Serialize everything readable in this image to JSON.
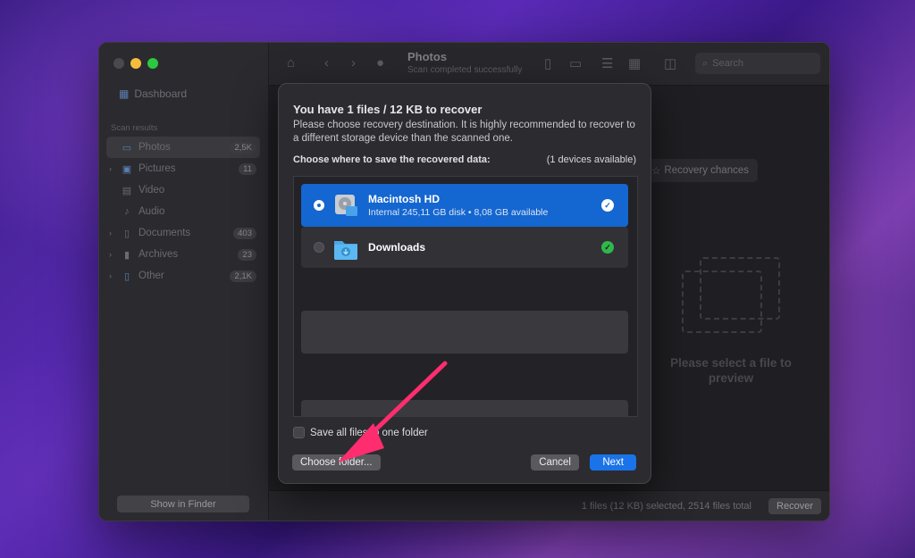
{
  "sidebar": {
    "dashboard_label": "Dashboard",
    "section_label": "Scan results",
    "items": [
      {
        "label": "Photos",
        "count": "2,5K",
        "icon": "hard-drive-icon"
      },
      {
        "label": "Pictures",
        "count": "11",
        "icon": "picture-icon"
      },
      {
        "label": "Video",
        "count": "",
        "icon": "film-icon"
      },
      {
        "label": "Audio",
        "count": "",
        "icon": "music-note-icon"
      },
      {
        "label": "Documents",
        "count": "403",
        "icon": "document-icon"
      },
      {
        "label": "Archives",
        "count": "23",
        "icon": "archive-icon"
      },
      {
        "label": "Other",
        "count": "2,1K",
        "icon": "file-icon"
      }
    ],
    "show_in_finder": "Show in Finder"
  },
  "toolbar": {
    "title": "Photos",
    "subtitle": "Scan completed successfully",
    "search_placeholder": "Search"
  },
  "main": {
    "recovery_chances": "Recovery chances",
    "preview_text": "Please select a file to preview"
  },
  "statusbar": {
    "status_text": "1 files (12 KB) selected, 2514 files total",
    "recover_label": "Recover"
  },
  "dialog": {
    "title": "You have 1 files / 12 KB to recover",
    "description": "Please choose recovery destination. It is highly recommended to recover to a different storage device than the scanned one.",
    "choose_label": "Choose where to save the recovered data:",
    "devices_available": "(1 devices available)",
    "destinations": [
      {
        "name": "Macintosh HD",
        "detail": "Internal 245,11 GB disk • 8,08 GB available",
        "selected": true
      },
      {
        "name": "Downloads",
        "detail": "",
        "selected": false
      }
    ],
    "save_all_label": "Save all files to one folder",
    "choose_folder_label": "Choose folder...",
    "cancel_label": "Cancel",
    "next_label": "Next"
  },
  "colors": {
    "accent_blue": "#1466d0",
    "annotation_arrow": "#ff2d6f",
    "check_green": "#2fb84a"
  }
}
